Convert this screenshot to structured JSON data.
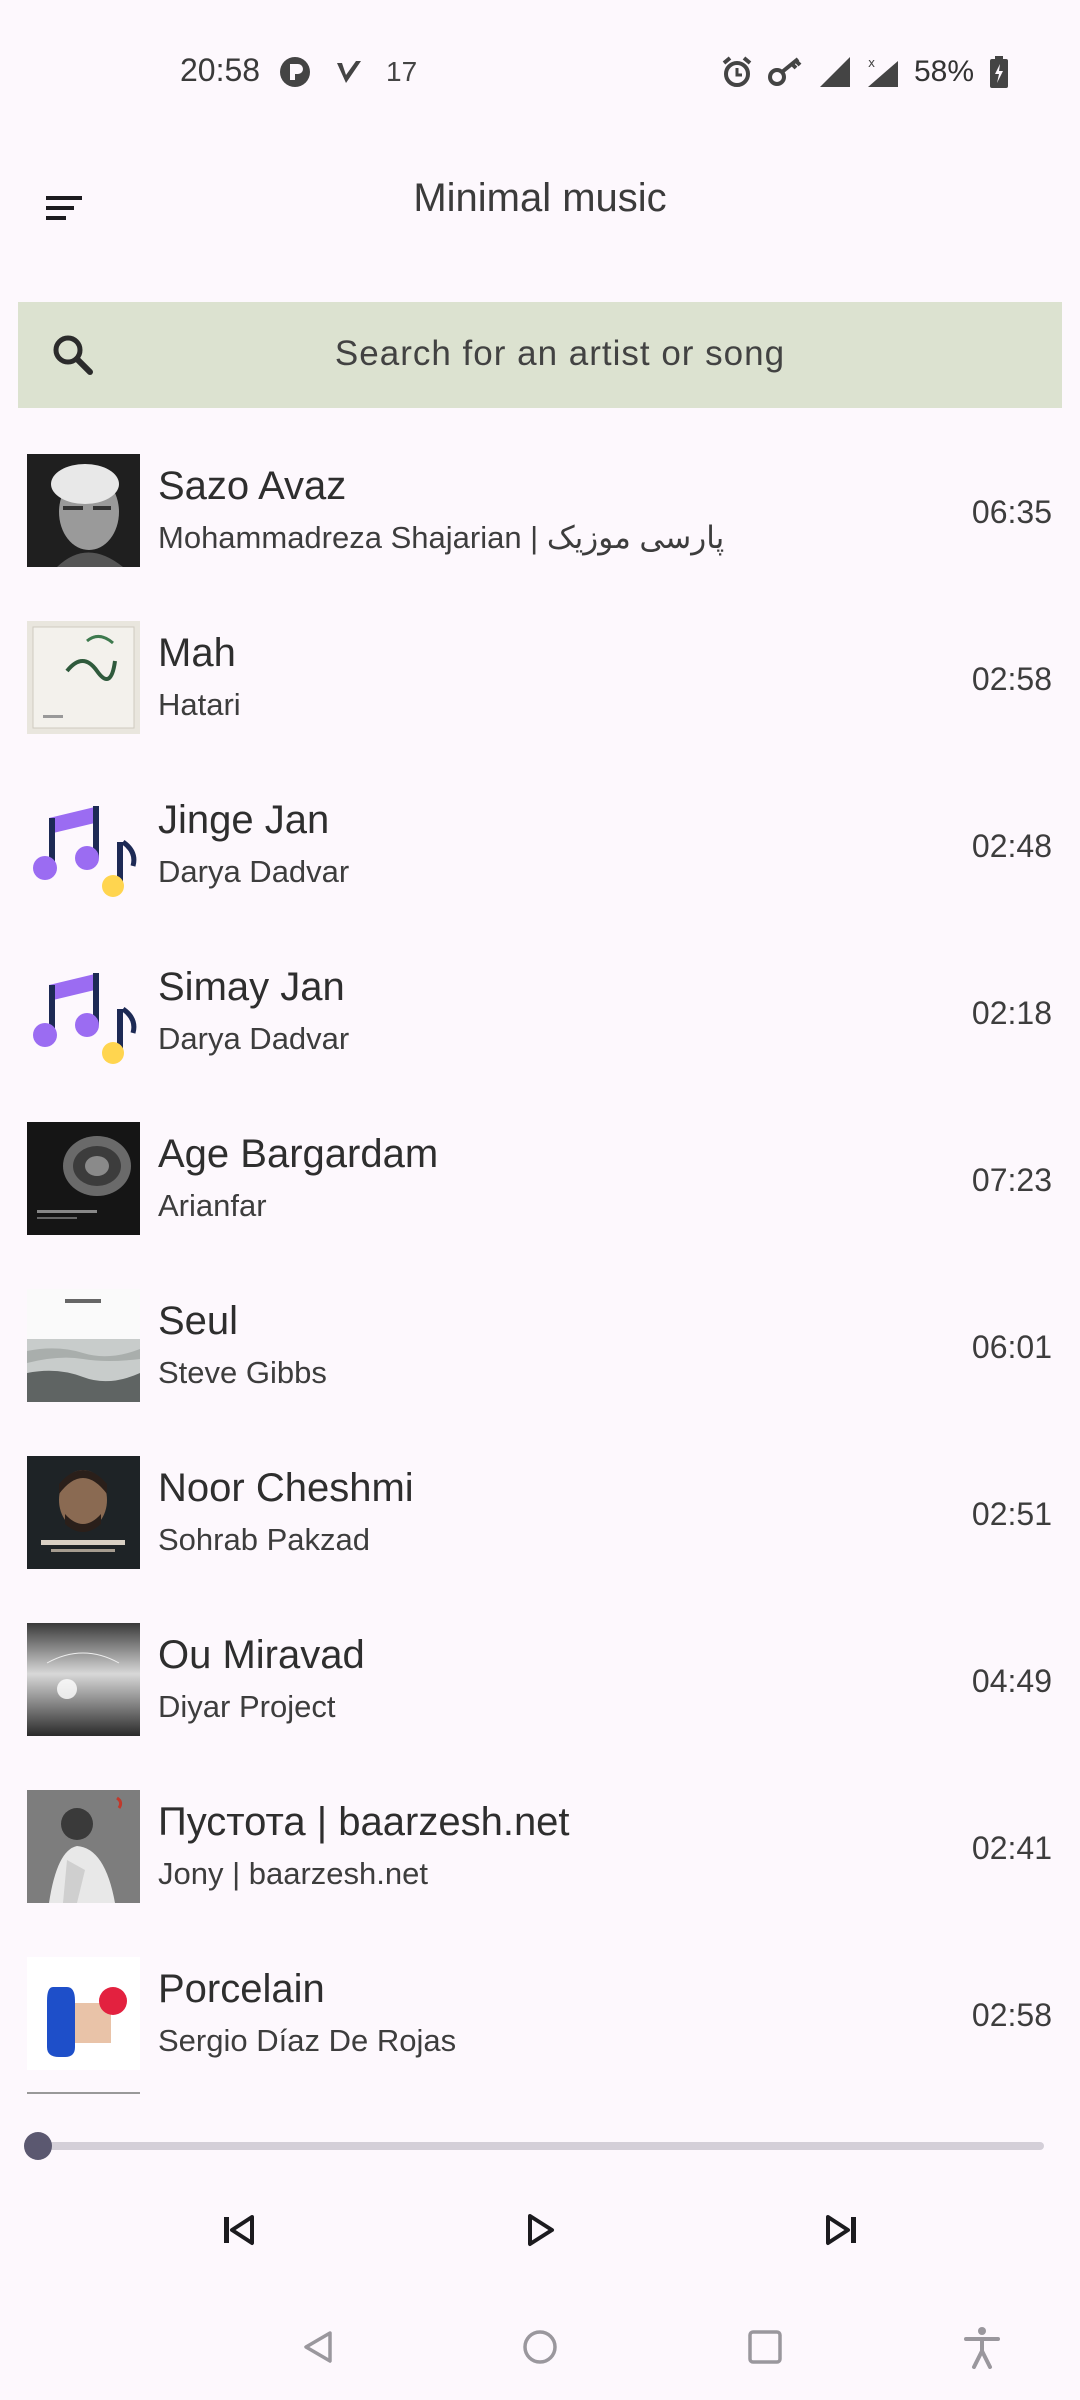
{
  "status": {
    "time": "20:58",
    "notif_count": "17",
    "battery": "58%"
  },
  "app": {
    "title": "Minimal music"
  },
  "search": {
    "placeholder": "Search for an artist or song"
  },
  "songs": [
    {
      "title": "Sazo Avaz",
      "artist": "Mohammadreza Shajarian | پارسی موزیک",
      "duration": "06:35",
      "art": "photo-portrait-bw"
    },
    {
      "title": "Mah",
      "artist": "Hatari",
      "duration": "02:58",
      "art": "album-calligraphy"
    },
    {
      "title": "Jinge Jan",
      "artist": "Darya Dadvar",
      "duration": "02:48",
      "art": "music-note-icon"
    },
    {
      "title": "Simay Jan",
      "artist": "Darya Dadvar",
      "duration": "02:18",
      "art": "music-note-icon"
    },
    {
      "title": "Age Bargardam",
      "artist": "Arianfar",
      "duration": "07:23",
      "art": "album-dark-abstract"
    },
    {
      "title": "Seul",
      "artist": "Steve Gibbs",
      "duration": "06:01",
      "art": "album-sea"
    },
    {
      "title": "Noor Cheshmi",
      "artist": "Sohrab Pakzad",
      "duration": "02:51",
      "art": "album-portrait"
    },
    {
      "title": "Ou Miravad",
      "artist": "Diyar Project",
      "duration": "04:49",
      "art": "album-misty"
    },
    {
      "title": "Пустота | baarzesh.net",
      "artist": "Jony | baarzesh.net",
      "duration": "02:41",
      "art": "album-person"
    },
    {
      "title": "Porcelain",
      "artist": "Sergio Díaz De Rojas",
      "duration": "02:58",
      "art": "album-shapes"
    }
  ],
  "player": {
    "progress": 0
  },
  "colors": {
    "background": "#fdf8fd",
    "search_bg": "#dce2d0",
    "note_purple": "#9b6cf2",
    "note_navy": "#1d2a55",
    "note_yellow": "#ffd54f"
  }
}
